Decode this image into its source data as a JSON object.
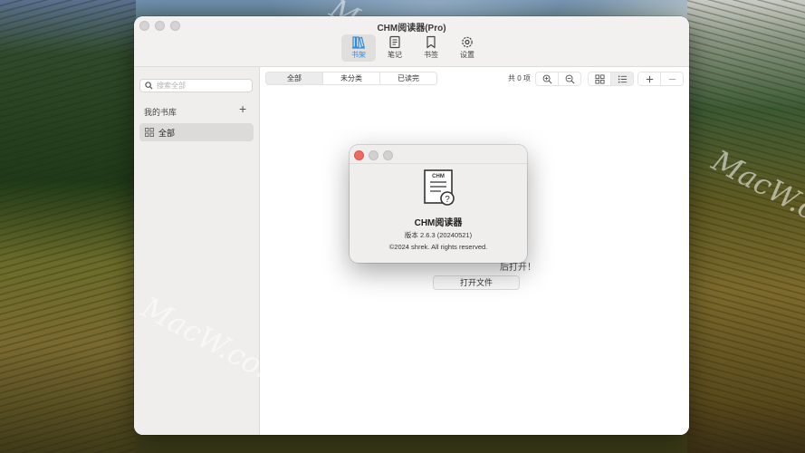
{
  "window": {
    "title": "CHM阅读器(Pro)"
  },
  "toolbar": {
    "items": [
      {
        "label": "书架",
        "icon": "bookshelf-icon",
        "active": true
      },
      {
        "label": "笔记",
        "icon": "notes-icon",
        "active": false
      },
      {
        "label": "书签",
        "icon": "bookmark-icon",
        "active": false
      },
      {
        "label": "设置",
        "icon": "gear-icon",
        "active": false
      }
    ],
    "accent_color": "#2f8de4"
  },
  "sidebar": {
    "search_placeholder": "搜索全部",
    "library_header": "我的书库",
    "add_symbol": "+",
    "items": [
      {
        "label": "全部",
        "selected": true
      }
    ]
  },
  "main": {
    "filters": [
      {
        "label": "全部",
        "selected": true
      },
      {
        "label": "未分类",
        "selected": false
      },
      {
        "label": "已读完",
        "selected": false
      }
    ],
    "count": "共 0 项",
    "empty_hint_tail": "后打开！",
    "open_button": "打开文件"
  },
  "about_dialog": {
    "app_name": "CHM阅读器",
    "icon_text": "CHM",
    "version": "版本 2.6.3 (20240521)",
    "copyright": "©2024 shrek. All rights reserved."
  },
  "watermark": "MacW.com"
}
